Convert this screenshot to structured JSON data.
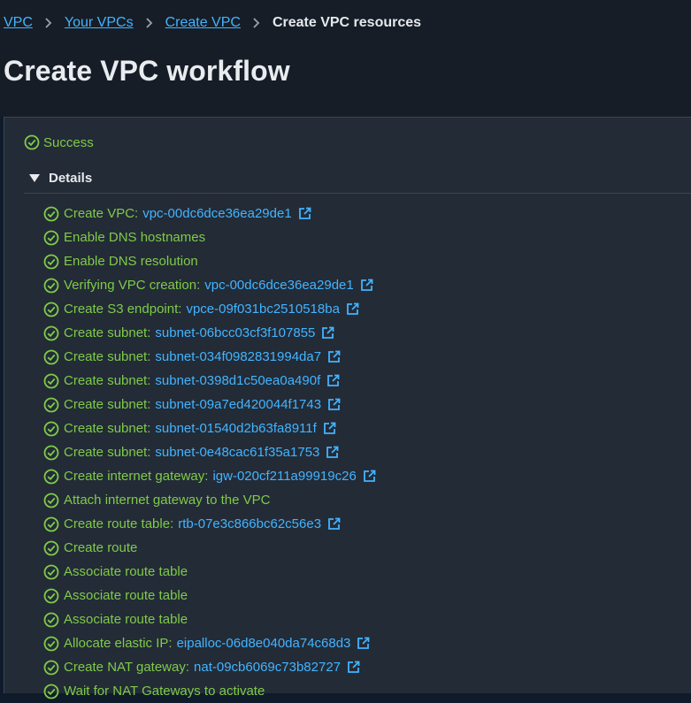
{
  "breadcrumb": {
    "items": [
      {
        "label": "VPC"
      },
      {
        "label": "Your VPCs"
      },
      {
        "label": "Create VPC"
      }
    ],
    "current": "Create VPC resources"
  },
  "page_title": "Create VPC workflow",
  "status": {
    "label": "Success",
    "color": "#7fcb48"
  },
  "details": {
    "label": "Details"
  },
  "steps": [
    {
      "label": "Create VPC:",
      "id": "vpc-00dc6dce36ea29de1"
    },
    {
      "label": "Enable DNS hostnames"
    },
    {
      "label": "Enable DNS resolution"
    },
    {
      "label": "Verifying VPC creation:",
      "id": "vpc-00dc6dce36ea29de1"
    },
    {
      "label": "Create S3 endpoint:",
      "id": "vpce-09f031bc2510518ba"
    },
    {
      "label": "Create subnet:",
      "id": "subnet-06bcc03cf3f107855"
    },
    {
      "label": "Create subnet:",
      "id": "subnet-034f0982831994da7"
    },
    {
      "label": "Create subnet:",
      "id": "subnet-0398d1c50ea0a490f"
    },
    {
      "label": "Create subnet:",
      "id": "subnet-09a7ed420044f1743"
    },
    {
      "label": "Create subnet:",
      "id": "subnet-01540d2b63fa8911f"
    },
    {
      "label": "Create subnet:",
      "id": "subnet-0e48cac61f35a1753"
    },
    {
      "label": "Create internet gateway:",
      "id": "igw-020cf211a99919c26"
    },
    {
      "label": "Attach internet gateway to the VPC"
    },
    {
      "label": "Create route table:",
      "id": "rtb-07e3c866bc62c56e3"
    },
    {
      "label": "Create route"
    },
    {
      "label": "Associate route table"
    },
    {
      "label": "Associate route table"
    },
    {
      "label": "Associate route table"
    },
    {
      "label": "Allocate elastic IP:",
      "id": "eipalloc-06d8e040da74c68d3"
    },
    {
      "label": "Create NAT gateway:",
      "id": "nat-09cb6069c73b82727"
    },
    {
      "label": "Wait for NAT Gateways to activate"
    }
  ],
  "colors": {
    "success": "#7fcb48",
    "link": "#42b4ff",
    "background": "#161d26",
    "panel": "#232b37"
  },
  "icons": {
    "status": "check-circle-icon",
    "external": "external-link-icon",
    "separator": "chevron-right-icon",
    "toggle": "caret-down-icon"
  }
}
